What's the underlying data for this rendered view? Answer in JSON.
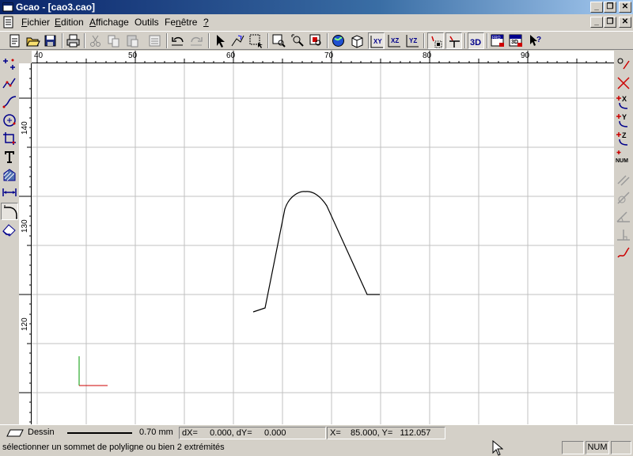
{
  "window": {
    "title": "Gcao - [cao3.cao]",
    "minimize": "_",
    "restore": "❐",
    "close": "✕"
  },
  "menu": [
    {
      "label_rest": "ichier",
      "mnemonic": "F"
    },
    {
      "label_rest": "dition",
      "mnemonic": "E"
    },
    {
      "label_rest": "ffichage",
      "mnemonic": "A"
    },
    {
      "label": "Outils"
    },
    {
      "label_pre": "Fe",
      "mnemonic": "n",
      "label_rest": "être"
    },
    {
      "label": "?"
    }
  ],
  "toolbar": {
    "icons": [
      "new-icon",
      "open-icon",
      "save-icon",
      "print-icon",
      "cut-icon",
      "copy-icon",
      "paste-icon",
      "properties-icon",
      "undo-icon",
      "redo-icon",
      "select-arrow-icon",
      "select-polyline-icon",
      "select-window-icon",
      "zoom-window-icon",
      "zoom-dynamic-icon",
      "zoom-extents-icon",
      "globe-icon",
      "cube-icon",
      "plane-xy-icon",
      "plane-xz-icon",
      "plane-yz-icon",
      "snap-grid-icon",
      "snap-ortho-icon",
      "view-3d-icon",
      "front-view-icon",
      "3d-view-icon",
      "help-cursor-icon"
    ],
    "labels": {
      "xy": "XY",
      "xz": "XZ",
      "yz": "YZ",
      "three_d": "3D",
      "fro": "FRO",
      "fr3d": "3D"
    }
  },
  "left_tools": [
    "point-icon",
    "polyline-icon",
    "curve-icon",
    "circle-icon",
    "trim-icon",
    "text-icon",
    "hatch-icon",
    "dimension-icon",
    "fillet-icon",
    "erase-icon"
  ],
  "right_tools": {
    "icons": [
      "snap-center-icon",
      "snap-intersection-icon",
      "snap-x-icon",
      "snap-y-icon",
      "snap-z-icon",
      "snap-num-icon",
      "snap-parallel-icon",
      "snap-tangent-icon",
      "snap-angle-icon",
      "snap-perpendicular-icon",
      "snap-curve-icon"
    ],
    "labels": {
      "x": "X",
      "y": "Y",
      "z": "Z",
      "num": "NUM"
    }
  },
  "rulers": {
    "top": [
      "40",
      "50",
      "60",
      "70",
      "80",
      "90"
    ],
    "left": [
      "140",
      "130",
      "120"
    ]
  },
  "colors": {
    "grid": "#c0c0c0",
    "drawing": "#000000",
    "axis_x": "#cc0000",
    "axis_y": "#009900"
  },
  "status": {
    "layer": "Dessin",
    "line_width": "0.70 mm",
    "delta": "dX=     0.000, dY=     0.000",
    "coords": "X=    85.000, Y=   112.057",
    "hint": "sélectionner un  sommet de polyligne ou bien 2 extrémités",
    "num": "NUM"
  }
}
